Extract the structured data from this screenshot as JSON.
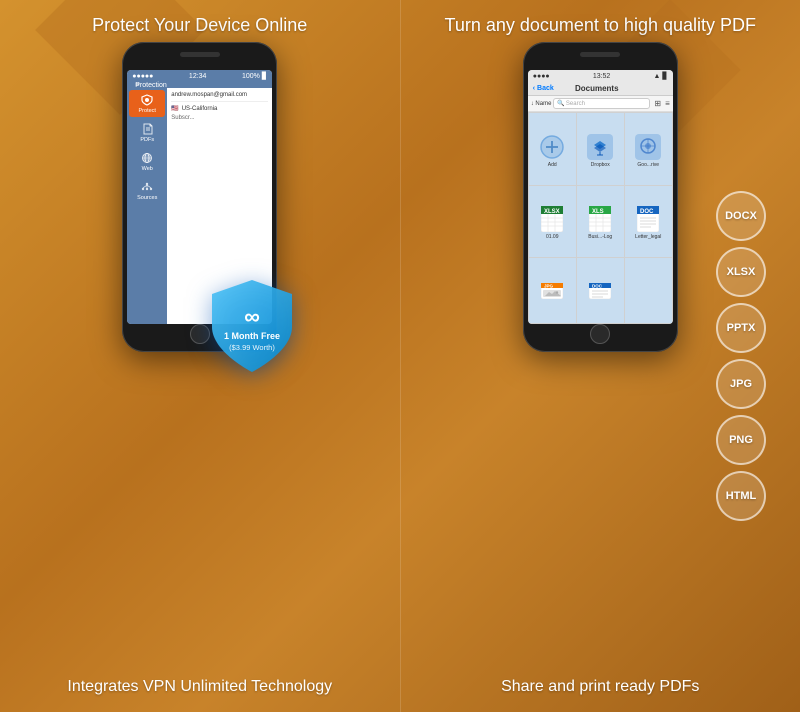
{
  "left": {
    "headline": "Protect Your Device\nOnline",
    "bottom_text": "Integrates VPN Unlimited\nTechnology",
    "phone": {
      "status_bar": {
        "dots": "●●●●●",
        "wifi": "WiFi",
        "time": "12:34",
        "battery": "100%"
      },
      "nav_title": "Protection",
      "nav_menu": "≡",
      "email": "andrew.mospan@gmail.com",
      "location": "US-California",
      "subscribe": "Subscr...",
      "sidebar_items": [
        {
          "label": "Protect",
          "active": true
        },
        {
          "label": "PDFs"
        },
        {
          "label": "Web"
        },
        {
          "label": "Sources"
        }
      ],
      "shield_text": "1 Month Free\n($3.99 Worth)"
    }
  },
  "right": {
    "headline": "Turn any document to\nhigh quality PDF",
    "bottom_text": "Share and print ready PDFs",
    "phone": {
      "status_bar": {
        "dots": "●●●●",
        "wifi": "WiFi",
        "time": "13:52",
        "battery": "▊"
      },
      "nav_back": "< Back",
      "nav_title": "Documents",
      "toolbar": {
        "sort": "↓ Name",
        "search_placeholder": "Search",
        "grid_icon": "⊞",
        "menu_icon": "≡"
      },
      "files": [
        {
          "label": "Add",
          "type": "add"
        },
        {
          "label": "Dropbox",
          "type": "dropbox"
        },
        {
          "label": "Goo...rive",
          "type": "drive"
        },
        {
          "label": "01.09",
          "type": "xlsx"
        },
        {
          "label": "Busi...-Log",
          "type": "xls"
        },
        {
          "label": "Letter_legal",
          "type": "doc"
        },
        {
          "label": "",
          "type": "jpg"
        },
        {
          "label": "",
          "type": "doc2"
        }
      ]
    },
    "formats": [
      "DOCX",
      "XLSX",
      "PPTX",
      "JPG",
      "PNG",
      "HTML"
    ]
  }
}
